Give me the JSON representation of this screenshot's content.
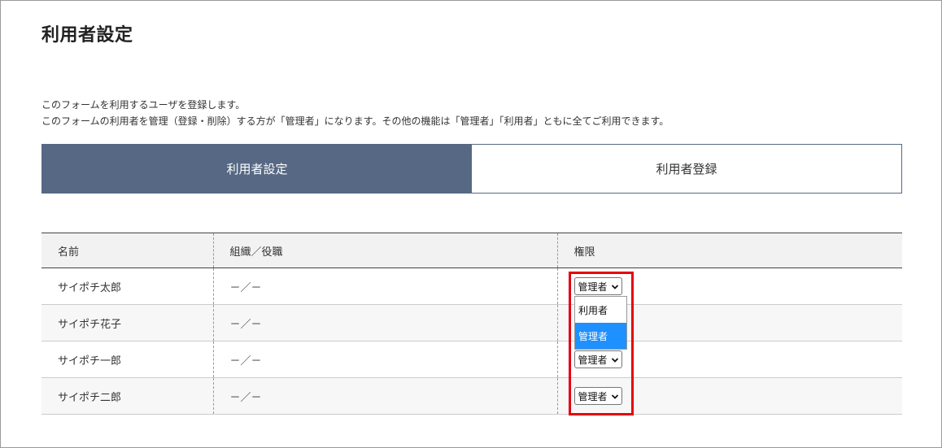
{
  "page": {
    "title": "利用者設定",
    "description": [
      "このフォームを利用するユーザを登録します。",
      "このフォームの利用者を管理（登録・削除）する方が「管理者」になります。その他の機能は「管理者」「利用者」ともに全てご利用できます。"
    ]
  },
  "tabs": {
    "active_label": "利用者設定",
    "inactive_label": "利用者登録"
  },
  "table": {
    "headers": [
      "名前",
      "組織／役職",
      "権限"
    ],
    "rows": [
      {
        "name": "サイポチ太郎",
        "org": "－／－",
        "role": "管理者"
      },
      {
        "name": "サイポチ花子",
        "org": "－／－",
        "role": ""
      },
      {
        "name": "サイポチ一郎",
        "org": "－／－",
        "role": "管理者"
      },
      {
        "name": "サイポチ二郎",
        "org": "－／－",
        "role": "管理者"
      }
    ]
  },
  "dropdown": {
    "options": [
      "利用者",
      "管理者"
    ],
    "selected": "管理者"
  },
  "colors": {
    "tab_active_bg": "#566883",
    "highlight_border": "#e60012",
    "dropdown_selected_bg": "#1e90ff"
  },
  "icons": {
    "select_arrow": "chevron-down-icon"
  }
}
